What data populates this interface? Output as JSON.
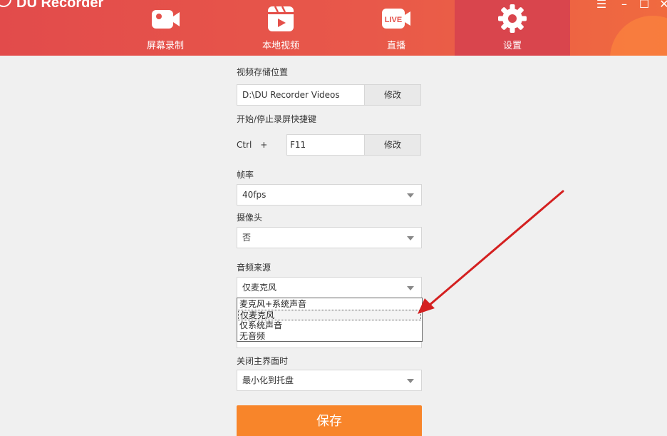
{
  "app": {
    "title": "DU Recorder"
  },
  "nav": [
    {
      "label": "屏幕录制",
      "icon": "camera-icon"
    },
    {
      "label": "本地视频",
      "icon": "video-clapper-icon"
    },
    {
      "label": "直播",
      "icon": "live-icon",
      "badge": "LIVE"
    },
    {
      "label": "设置",
      "icon": "gear-icon",
      "active": true
    }
  ],
  "window_controls": {
    "menu": "☰",
    "minimize": "–",
    "maximize": "☐",
    "close": "✕"
  },
  "settings": {
    "storage": {
      "label": "视频存储位置",
      "value": "D:\\DU Recorder Videos",
      "button": "修改"
    },
    "hotkey": {
      "label": "开始/停止录屏快捷键",
      "modifier": "Ctrl",
      "plus": "+",
      "key": "F11",
      "button": "修改"
    },
    "framerate": {
      "label": "帧率",
      "value": "40fps"
    },
    "camera": {
      "label": "摄像头",
      "value": "否"
    },
    "audio": {
      "label": "音频来源",
      "value": "仅麦克风",
      "options": [
        "麦克风+系统声音",
        "仅麦克风",
        "仅系统声音",
        "无音频"
      ],
      "selected_index": 1
    },
    "close_behavior": {
      "label": "关闭主界面时",
      "value": "最小化到托盘"
    },
    "save": "保存"
  },
  "colors": {
    "header_start": "#e24b4b",
    "header_end": "#f06a3f",
    "active_tab": "#d9454d",
    "save_button": "#f8852a",
    "arrow": "#d42020"
  }
}
